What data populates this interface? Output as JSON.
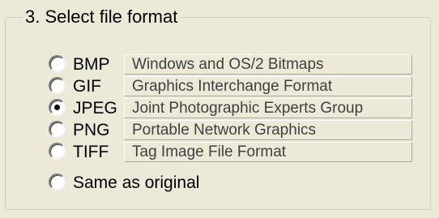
{
  "group": {
    "title": "3. Select file format"
  },
  "formats": [
    {
      "code": "BMP",
      "description": "Windows and OS/2 Bitmaps",
      "selected": false
    },
    {
      "code": "GIF",
      "description": "Graphics Interchange Format",
      "selected": false
    },
    {
      "code": "JPEG",
      "description": "Joint Photographic Experts Group",
      "selected": true
    },
    {
      "code": "PNG",
      "description": "Portable Network Graphics",
      "selected": false
    },
    {
      "code": "TIFF",
      "description": "Tag Image File Format",
      "selected": false
    }
  ],
  "same_as_original": {
    "label": "Same as original",
    "selected": false
  },
  "colors": {
    "background": "#ECE9D8",
    "groupbox_border": "#D0D0BF",
    "description_text": "#404040"
  }
}
